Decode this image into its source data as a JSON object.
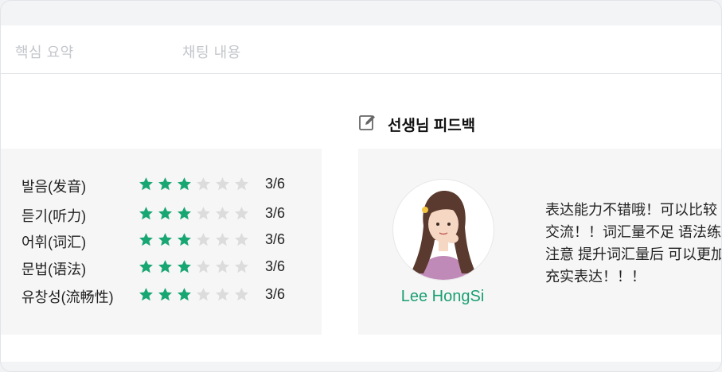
{
  "tabs": [
    {
      "label": "핵심 요약"
    },
    {
      "label": "채팅 내용"
    }
  ],
  "ratings": [
    {
      "label": "발음(发音)",
      "score": "3/6",
      "stars_filled": 3,
      "stars_total": 6
    },
    {
      "label": "듣기(听力)",
      "score": "3/6",
      "stars_filled": 3,
      "stars_total": 6
    },
    {
      "label": "어휘(词汇)",
      "score": "3/6",
      "stars_filled": 3,
      "stars_total": 6
    },
    {
      "label": "문법(语法)",
      "score": "3/6",
      "stars_filled": 3,
      "stars_total": 6
    },
    {
      "label": "유창성(流畅性)",
      "score": "3/6",
      "stars_filled": 3,
      "stars_total": 6
    }
  ],
  "feedback": {
    "title": "선생님 피드백",
    "teacher_name": "Lee HongSi",
    "lines": [
      "表达能力不错哦！可以比较",
      "交流！！词汇量不足 语法练",
      "注意 提升词汇量后 可以更加",
      "充实表达！！！"
    ]
  },
  "colors": {
    "star_filled": "#18a673",
    "star_empty": "#dcdcdc",
    "accent": "#1a9f72"
  },
  "icons": {
    "feedback_title": "edit-icon",
    "star": "star-icon"
  }
}
